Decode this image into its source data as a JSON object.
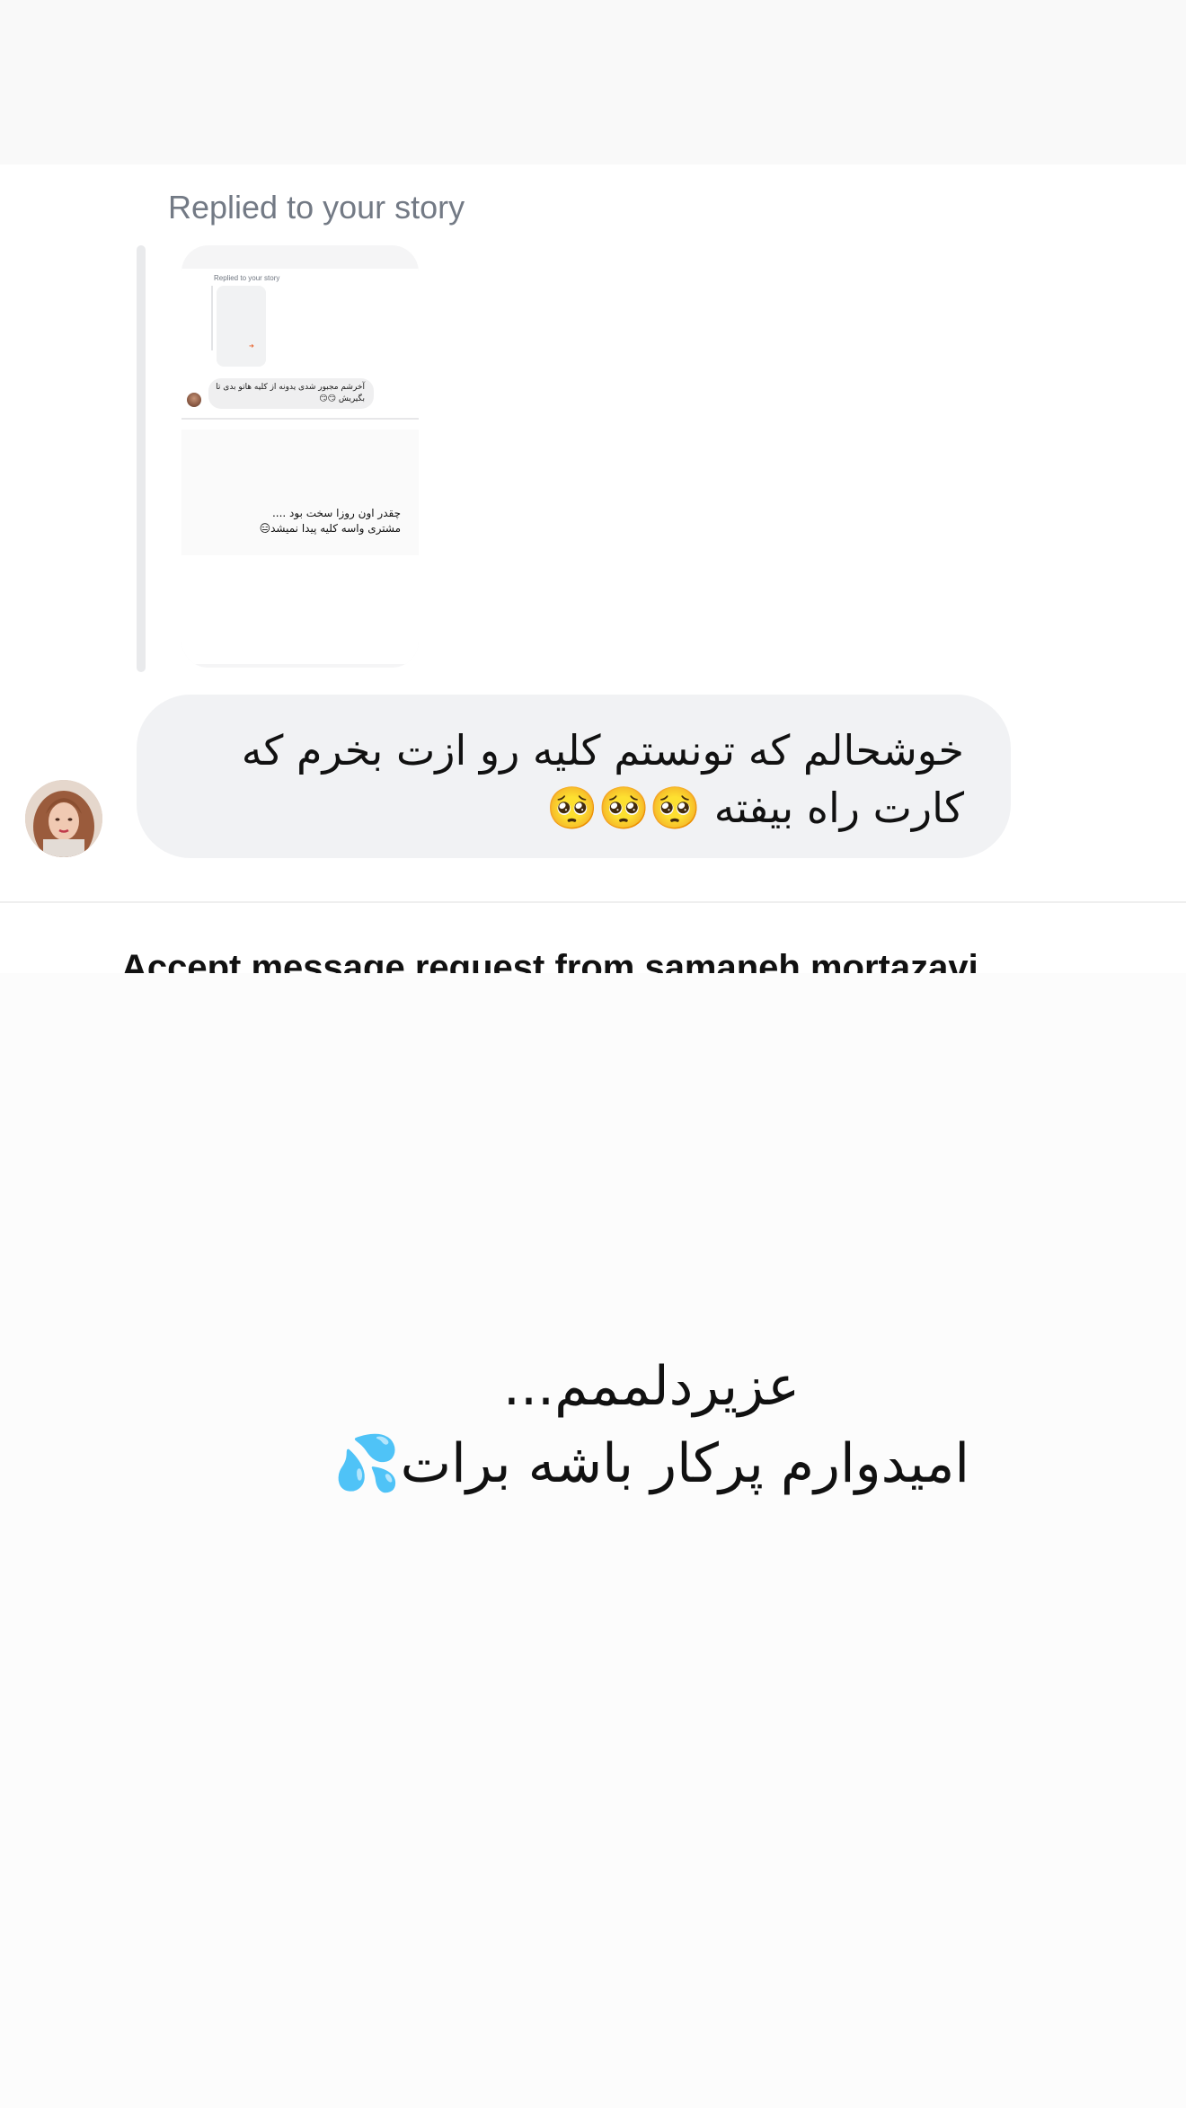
{
  "story_reply": {
    "caption": "Replied to your story",
    "thumbnail": {
      "caption": "Replied to your story",
      "bubble_text": "آخرشم مجبور شدی یدونه از کلیه هاتو بدی تا بگیریش 😏😏",
      "lower_text": "چقدر اون روزا سخت بود ....\nمشتری واسه کلیه پیدا نمیشد😑"
    }
  },
  "message": {
    "text": "خوشحالم که تونستم کلیه رو ازت بخرم که کارت راه بیفته 🥺🥺🥺"
  },
  "accept_banner": {
    "text": "Accept message request from samaneh.mortazavi"
  },
  "overlay": {
    "text": "عزیردلممم...\nامیدوارم پرکار باشه برات💦"
  }
}
